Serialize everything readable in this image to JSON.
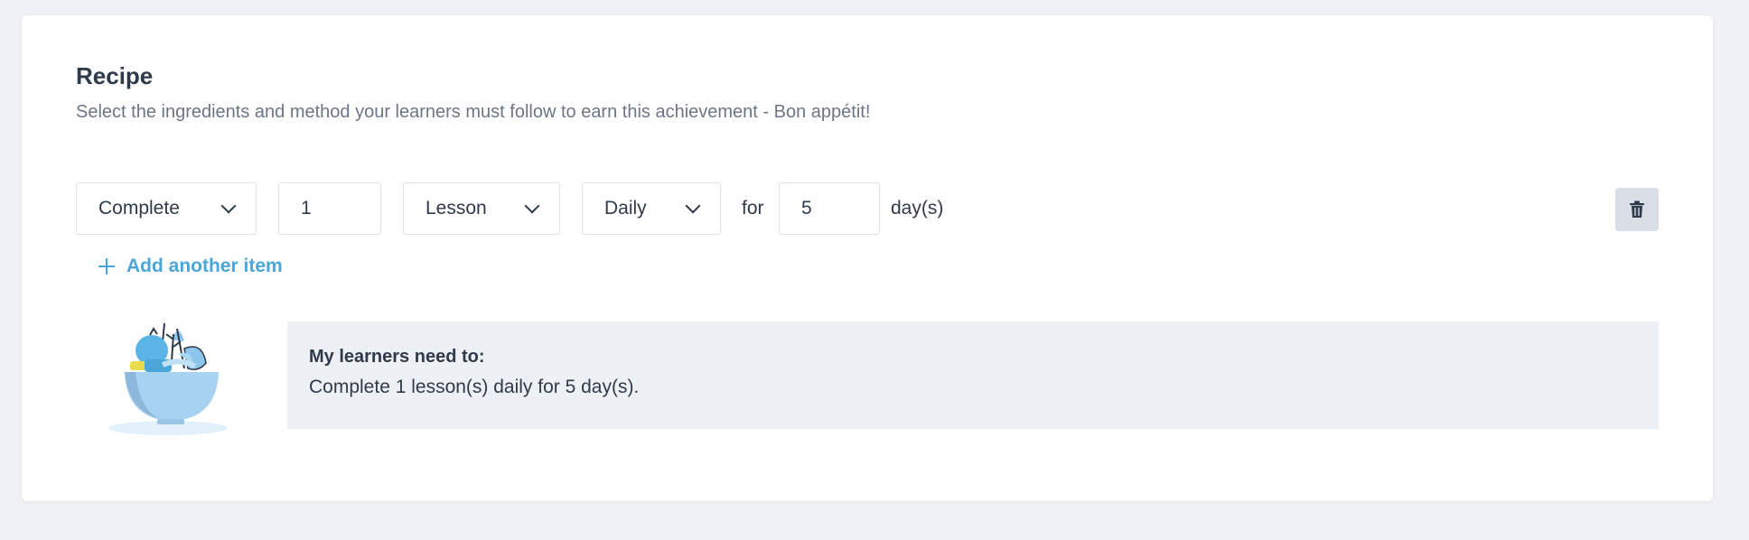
{
  "recipe": {
    "title": "Recipe",
    "subtitle": "Select the ingredients and method your learners must follow to earn this achievement - Bon appétit!"
  },
  "rule": {
    "action_select": "Complete",
    "count_input": "1",
    "type_select": "Lesson",
    "frequency_select": "Daily",
    "for_label": "for",
    "days_input": "5",
    "days_unit": "day(s)"
  },
  "add_item_label": "Add another item",
  "summary": {
    "heading": "My learners need to:",
    "text": "Complete 1 lesson(s) daily for 5 day(s)."
  },
  "icons": {
    "chevron": "chevron-down-icon",
    "trash": "trash-icon",
    "plus": "plus-icon",
    "illustration": "recipe-bowl-illustration"
  },
  "colors": {
    "accent": "#4aa6d9",
    "page_bg": "#eef1f5",
    "summary_bg": "#edf0f4"
  }
}
